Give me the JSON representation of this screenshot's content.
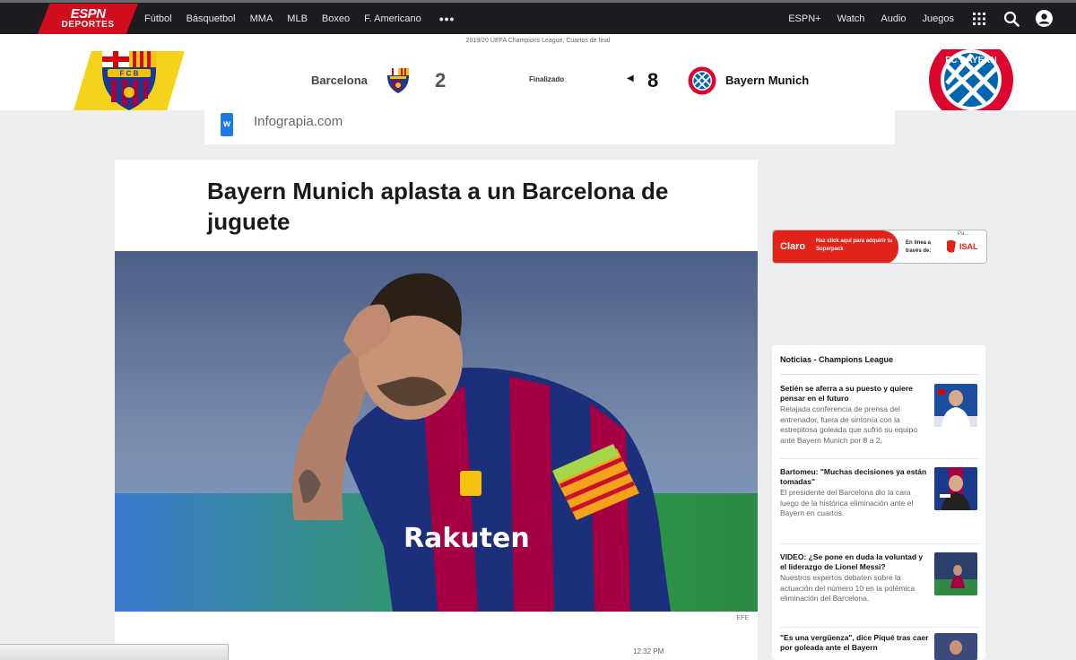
{
  "nav": {
    "logo_line1": "ESPN",
    "logo_line2": "DEPORTES",
    "links": [
      "Fútbol",
      "Básquetbol",
      "MMA",
      "MLB",
      "Boxeo",
      "F. Americano"
    ],
    "more": "•••",
    "right_links": [
      "ESPN+",
      "Watch",
      "Audio",
      "Juegos"
    ],
    "icons": [
      "grid-icon",
      "search-icon",
      "user-icon"
    ]
  },
  "scoreboard": {
    "competition": "2019/20 UEFA Champions League, Cuartos de final",
    "home_team": "Barcelona",
    "home_score": "2",
    "status": "Finalizado",
    "away_score": "8",
    "away_team": "Bayern Munich"
  },
  "ad_strip": {
    "text": "Infograpia.com"
  },
  "article": {
    "headline": "Bayern Munich aplasta a un Barcelona de juguete",
    "photo_credit": "EFE",
    "time": "12:32 PM"
  },
  "claro_ad": {
    "brand": "Claro",
    "message": "Haz click aquí para adquirir tu Superpack",
    "right_text": "En línea a través de:",
    "partner": "ISAL",
    "select": "Pa..."
  },
  "news": {
    "title": "Noticias - Champions League",
    "items": [
      {
        "headline": "Setién se aferra a su puesto y quiere pensar en el futuro",
        "desc": "Relajada conferencia de prensa del entrenador, fuera de sintonía con la estrepitosa goleada que sufrió su equipo ante Bayern Munich por 8 a 2."
      },
      {
        "headline": "Bartomeu: \"Muchas decisiones ya están tomadas\"",
        "desc": "El presidente del Barcelona dio la cara luego de la histórica eliminación ante el Bayern en cuartos."
      },
      {
        "headline": "VIDEO: ¿Se pone en duda la voluntad y el liderazgo de Lionel Messi?",
        "desc": "Nuestros expertos debaten sobre la actuación del número 10 en la polémica eliminación del Barcelona."
      },
      {
        "headline": "\"Es una vergüenza\", dice Piqué tras caer por goleada ante el Bayern",
        "desc": ""
      }
    ]
  },
  "colors": {
    "espn_red": "#d00d1c",
    "nav_bg": "#1c1d20",
    "barca_blue": "#1b3a8c",
    "barca_red": "#a50044",
    "bayern_red": "#dc052d",
    "claro_red": "#e2231a"
  }
}
